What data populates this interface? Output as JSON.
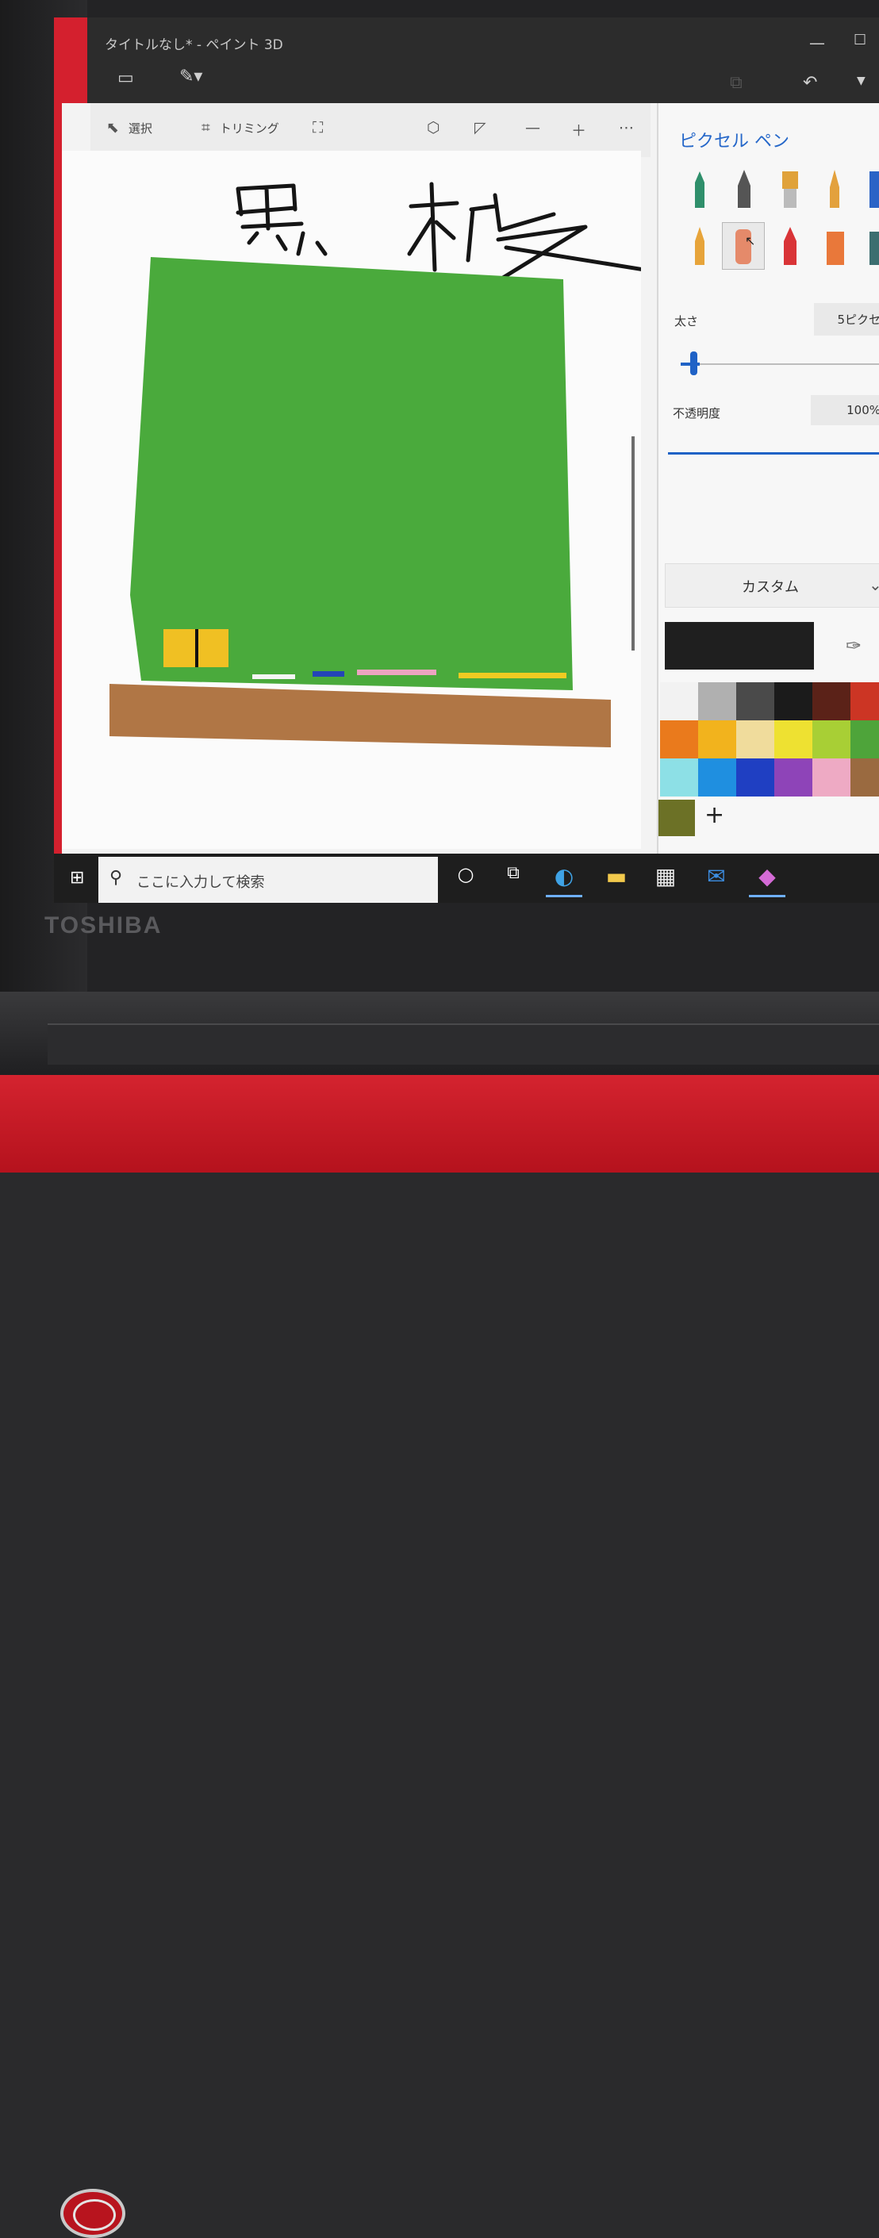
{
  "window": {
    "title": "タイトルなし* - ペイント 3D"
  },
  "toolbar": {
    "select_label": "選択",
    "trim_label": "トリミング"
  },
  "canvas": {
    "handwritten_text": "黒板"
  },
  "panel": {
    "title": "ピクセル ペン",
    "thickness_label": "太さ",
    "thickness_value": "5ピクセ",
    "opacity_label": "不透明度",
    "opacity_value": "100%",
    "color_mode_label": "カスタム",
    "current_color": "#1f1f1f",
    "custom_color": "#6c7126",
    "swatches": [
      "#f2f2f2",
      "#b0b0b0",
      "#4a4a4a",
      "#1b1b1b",
      "#5b2218",
      "#cc3524",
      "#ea7a1c",
      "#f2b31d",
      "#f0dc9c",
      "#eee131",
      "#a8cf35",
      "#4ea43a",
      "#8de0e6",
      "#1f8fe0",
      "#1f3fc2",
      "#8e44b8",
      "#eeaac4",
      "#9a6a40"
    ]
  },
  "taskbar": {
    "search_placeholder": "ここに入力して検索"
  },
  "laptop": {
    "brand": "TOSHIBA"
  }
}
